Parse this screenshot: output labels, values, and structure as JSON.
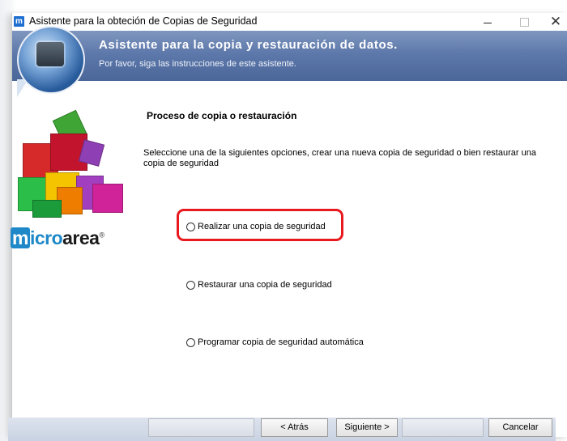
{
  "window": {
    "title": "Asistente para la obteción de Copias de Seguridad",
    "app_icon_letter": "m",
    "controls": {
      "minimize": "—",
      "maximize": "□",
      "close": "✕"
    }
  },
  "banner": {
    "title": "Asistente para la copia y restauración de datos.",
    "subtitle": "Por favor, siga las instrucciones de este asistente."
  },
  "logo": {
    "text_m": "m",
    "text_icro": "icro",
    "text_area": "area",
    "mark": "®"
  },
  "main": {
    "section_title": "Proceso de copia o restauración",
    "instructions": "Seleccione una de la siguientes opciones, crear una nueva copia de seguridad o bien restaurar una copia de seguridad",
    "options": [
      {
        "label": "Realizar una copia de seguridad",
        "selected": false,
        "highlighted": true
      },
      {
        "label": "Restaurar una copia de seguridad",
        "selected": false
      },
      {
        "label": "Programar copia de seguridad automática",
        "selected": false
      }
    ]
  },
  "buttons": {
    "back": "< Atrás",
    "next": "Siguiente >",
    "cancel": "Cancelar"
  },
  "colors": {
    "banner": "#5d78aa",
    "highlight": "#e8191f",
    "logo_blue": "#1e88c8"
  }
}
